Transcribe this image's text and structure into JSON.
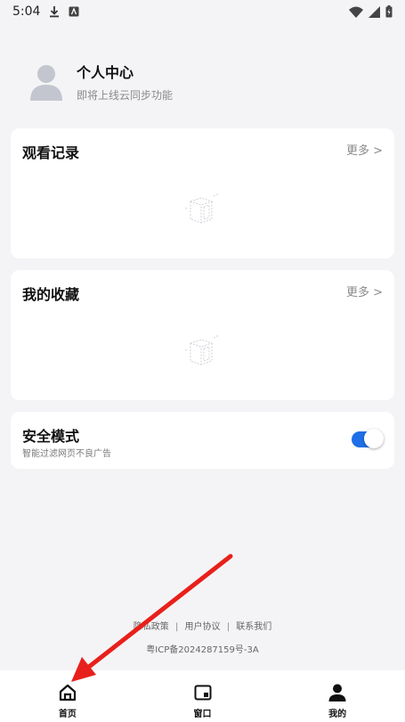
{
  "status_bar": {
    "time": "5:04",
    "left_icons": [
      "download-icon",
      "app-notification-icon"
    ],
    "right_icons": [
      "wifi-icon",
      "signal-icon",
      "battery-icon"
    ]
  },
  "profile": {
    "title": "个人中心",
    "subtitle": "即将上线云同步功能"
  },
  "history": {
    "title": "观看记录",
    "more_label": "更多 >"
  },
  "favorites": {
    "title": "我的收藏",
    "more_label": "更多 >"
  },
  "safe_mode": {
    "title": "安全模式",
    "subtitle": "智能过滤网页不良广告",
    "enabled": true
  },
  "footer": {
    "privacy": "隐私政策",
    "sep1": "|",
    "agreement": "用户协议",
    "sep2": "|",
    "contact": "联系我们",
    "icp": "粤ICP备2024287159号-3A"
  },
  "bottom_nav": {
    "home": "首页",
    "window": "窗口",
    "mine": "我的"
  },
  "colors": {
    "background": "#f4f4f6",
    "toggle_on": "#1f6fe6",
    "annotation_arrow": "#e8201b"
  }
}
